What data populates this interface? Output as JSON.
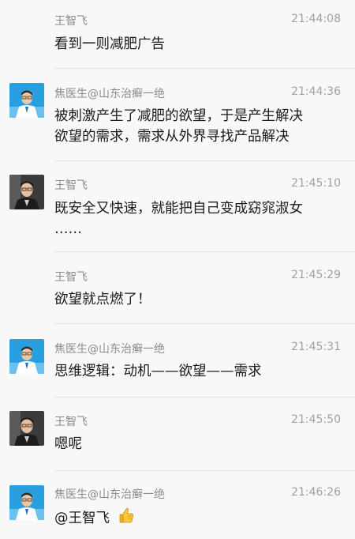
{
  "messages": [
    {
      "sender": "王智飞",
      "time": "21:44:08",
      "lines": [
        "看到一则减肥广告"
      ],
      "avatar": "none"
    },
    {
      "sender": "焦医生@山东治癣一绝",
      "time": "21:44:36",
      "lines": [
        "被刺激产生了减肥的欲望，于是产生解决",
        "欲望的需求，需求从外界寻找产品解决"
      ],
      "avatar": "doctor-avatar"
    },
    {
      "sender": "王智飞",
      "time": "21:45:10",
      "lines": [
        "既安全又快速，就能把自己变成窈窕淑女",
        "……"
      ],
      "avatar": "wang-avatar"
    },
    {
      "sender": "王智飞",
      "time": "21:45:29",
      "lines": [
        "欲望就点燃了！"
      ],
      "avatar": "none"
    },
    {
      "sender": "焦医生@山东治癣一绝",
      "time": "21:45:31",
      "lines": [
        "思维逻辑：动机——欲望——需求"
      ],
      "avatar": "doctor-avatar"
    },
    {
      "sender": "王智飞",
      "time": "21:45:50",
      "lines": [
        "嗯呢"
      ],
      "avatar": "wang-avatar"
    },
    {
      "sender": "焦医生@山东治癣一绝",
      "time": "21:46:26",
      "lines": [
        "@王智飞"
      ],
      "avatar": "doctor-avatar",
      "emoji": "thumbs-up-icon"
    }
  ],
  "colors": {
    "background": "#f8f8f8",
    "separator": "#e3e3e3",
    "name": "#8a8a8a",
    "time": "#a0a0a0",
    "text": "#1a1a1a"
  }
}
